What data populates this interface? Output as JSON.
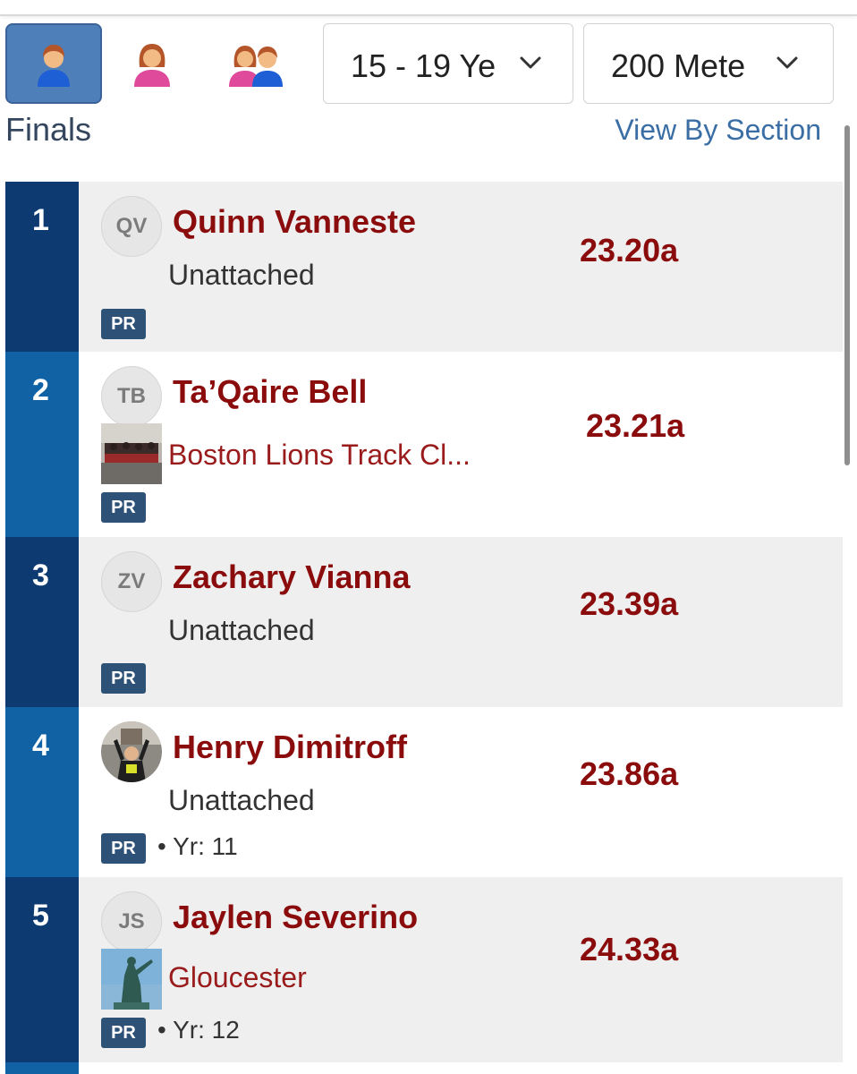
{
  "toolbar": {
    "gender_buttons": [
      {
        "name": "male",
        "active": true
      },
      {
        "name": "female",
        "active": false
      },
      {
        "name": "mixed",
        "active": false
      }
    ],
    "age_dropdown": {
      "value": "15 - 19 Ye",
      "icon": "chevron-down-icon"
    },
    "event_dropdown": {
      "value": "200 Mete",
      "icon": "chevron-down-icon"
    }
  },
  "section": {
    "title": "Finals",
    "view_by_section_label": "View By Section"
  },
  "colors": {
    "place_dark": "#0d3a70",
    "place_mid": "#1062a5",
    "row_gray": "#efefef",
    "row_white": "#ffffff",
    "name_red": "#8b0c0c",
    "pr_badge": "#2e5177"
  },
  "results": [
    {
      "place": "1",
      "initials": "QV",
      "name": "Quinn Vanneste",
      "team": "Unattached",
      "badge": "PR",
      "year": "",
      "mark": "23.20a"
    },
    {
      "place": "2",
      "initials": "TB",
      "name": "Ta’Qaire Bell",
      "team": "Boston Lions Track Cl...",
      "badge": "PR",
      "year": "",
      "mark": "23.21a"
    },
    {
      "place": "3",
      "initials": "ZV",
      "name": "Zachary Vianna",
      "team": "Unattached",
      "badge": "PR",
      "year": "",
      "mark": "23.39a"
    },
    {
      "place": "4",
      "initials": "",
      "name": "Henry Dimitroff",
      "team": "Unattached",
      "badge": "PR",
      "year": "• Yr: 11",
      "mark": "23.86a"
    },
    {
      "place": "5",
      "initials": "JS",
      "name": "Jaylen Severino",
      "team": "Gloucester",
      "badge": "PR",
      "year": "• Yr: 12",
      "mark": "24.33a"
    }
  ]
}
